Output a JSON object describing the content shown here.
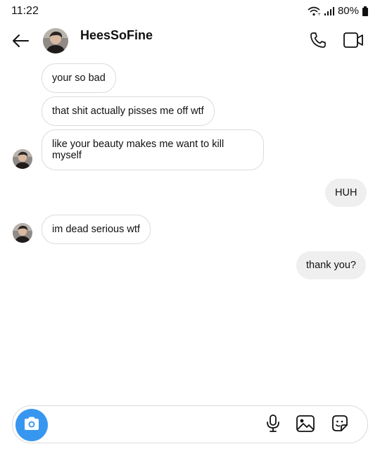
{
  "status_bar": {
    "time": "11:22",
    "battery": "80%"
  },
  "header": {
    "contact_name": "HeesSoFine",
    "avatar_icon": "profile-photo"
  },
  "messages": [
    {
      "direction": "in",
      "text": "your so bad",
      "show_avatar": false
    },
    {
      "direction": "in",
      "text": "that shit actually pisses me off wtf",
      "show_avatar": false
    },
    {
      "direction": "in",
      "text": "like your beauty makes me want to kill myself",
      "show_avatar": true
    },
    {
      "direction": "out",
      "text": "HUH"
    },
    {
      "direction": "in",
      "text": "im dead serious wtf",
      "show_avatar": true
    },
    {
      "direction": "out",
      "text": "thank you?"
    }
  ],
  "composer": {
    "placeholder": "",
    "camera_icon": "camera-icon",
    "mic_icon": "microphone-icon",
    "gallery_icon": "image-icon",
    "sticker_icon": "sticker-icon"
  },
  "colors": {
    "accent": "#3797f0",
    "outgoing_bubble": "#efefef",
    "incoming_border": "#dbdbdb"
  }
}
